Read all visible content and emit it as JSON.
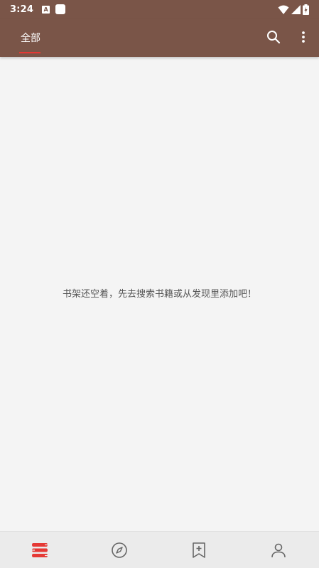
{
  "status_bar": {
    "time": "3:24",
    "notification_icon_letter": "A"
  },
  "app_bar": {
    "tabs": [
      {
        "label": "全部",
        "selected": true
      }
    ],
    "search_icon": "search-icon",
    "more_icon": "more-vert-icon"
  },
  "content": {
    "empty_message": "书架还空着，先去搜索书籍或从发现里添加吧！"
  },
  "bottom_nav": {
    "items": [
      {
        "icon": "bookshelf-icon",
        "selected": true
      },
      {
        "icon": "compass-icon",
        "selected": false
      },
      {
        "icon": "bookmark-add-icon",
        "selected": false
      },
      {
        "icon": "person-icon",
        "selected": false
      }
    ]
  },
  "colors": {
    "primary": "#7a5548",
    "accent": "#e53935",
    "background": "#f4f4f4",
    "nav_background": "#ebebeb"
  }
}
